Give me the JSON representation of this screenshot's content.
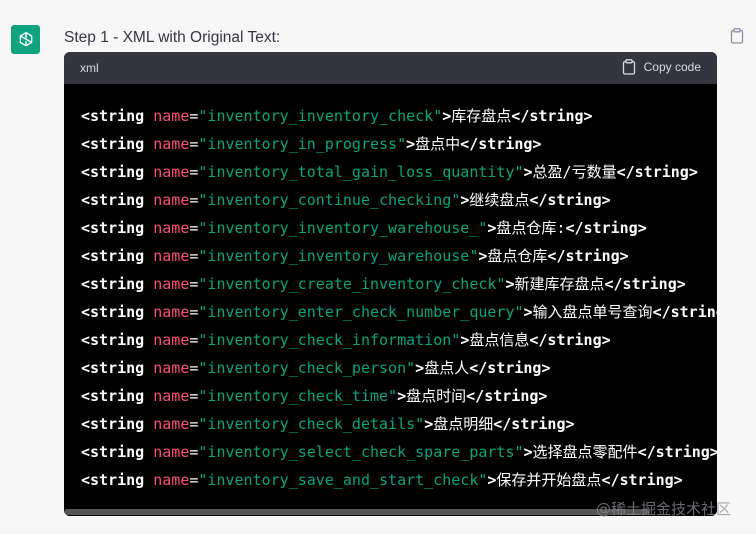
{
  "step_title": "Step 1 - XML with Original Text:",
  "code_block": {
    "language": "xml",
    "copy_label": "Copy code",
    "lines": [
      {
        "open": "<string ",
        "attr": "name",
        "value": "\"inventory_inventory_check\"",
        "text": "库存盘点",
        "close": "</string>"
      },
      {
        "open": "<string ",
        "attr": "name",
        "value": "\"inventory_in_progress\"",
        "text": "盘点中",
        "close": "</string>"
      },
      {
        "open": "<string ",
        "attr": "name",
        "value": "\"inventory_total_gain_loss_quantity\"",
        "text": "总盈/亏数量",
        "close": "</string>"
      },
      {
        "open": "<string ",
        "attr": "name",
        "value": "\"inventory_continue_checking\"",
        "text": "继续盘点",
        "close": "</string>"
      },
      {
        "open": "<string ",
        "attr": "name",
        "value": "\"inventory_inventory_warehouse_\"",
        "text": "盘点仓库:",
        "close": "</string>"
      },
      {
        "open": "<string ",
        "attr": "name",
        "value": "\"inventory_inventory_warehouse\"",
        "text": "盘点仓库",
        "close": "</string>"
      },
      {
        "open": "<string ",
        "attr": "name",
        "value": "\"inventory_create_inventory_check\"",
        "text": "新建库存盘点",
        "close": "</string>"
      },
      {
        "open": "<string ",
        "attr": "name",
        "value": "\"inventory_enter_check_number_query\"",
        "text": "输入盘点单号查询",
        "close": "</string>"
      },
      {
        "open": "<string ",
        "attr": "name",
        "value": "\"inventory_check_information\"",
        "text": "盘点信息",
        "close": "</string>"
      },
      {
        "open": "<string ",
        "attr": "name",
        "value": "\"inventory_check_person\"",
        "text": "盘点人",
        "close": "</string>"
      },
      {
        "open": "<string ",
        "attr": "name",
        "value": "\"inventory_check_time\"",
        "text": "盘点时间",
        "close": "</string>"
      },
      {
        "open": "<string ",
        "attr": "name",
        "value": "\"inventory_check_details\"",
        "text": "盘点明细",
        "close": "</string>"
      },
      {
        "open": "<string ",
        "attr": "name",
        "value": "\"inventory_select_check_spare_parts\"",
        "text": "选择盘点零配件",
        "close": "</string>"
      },
      {
        "open": "<string ",
        "attr": "name",
        "value": "\"inventory_save_and_start_check\"",
        "text": "保存并开始盘点",
        "close": "</string>"
      }
    ]
  },
  "watermark": "@稀土掘金技术社区",
  "icons": {
    "avatar": "openai-logo-icon",
    "copy": "clipboard-icon"
  },
  "colors": {
    "avatar_bg": "#10a37f",
    "code_bg": "#000000",
    "header_bg": "#343541",
    "attr_color": "#ff4a73",
    "string_color": "#00a67d"
  }
}
